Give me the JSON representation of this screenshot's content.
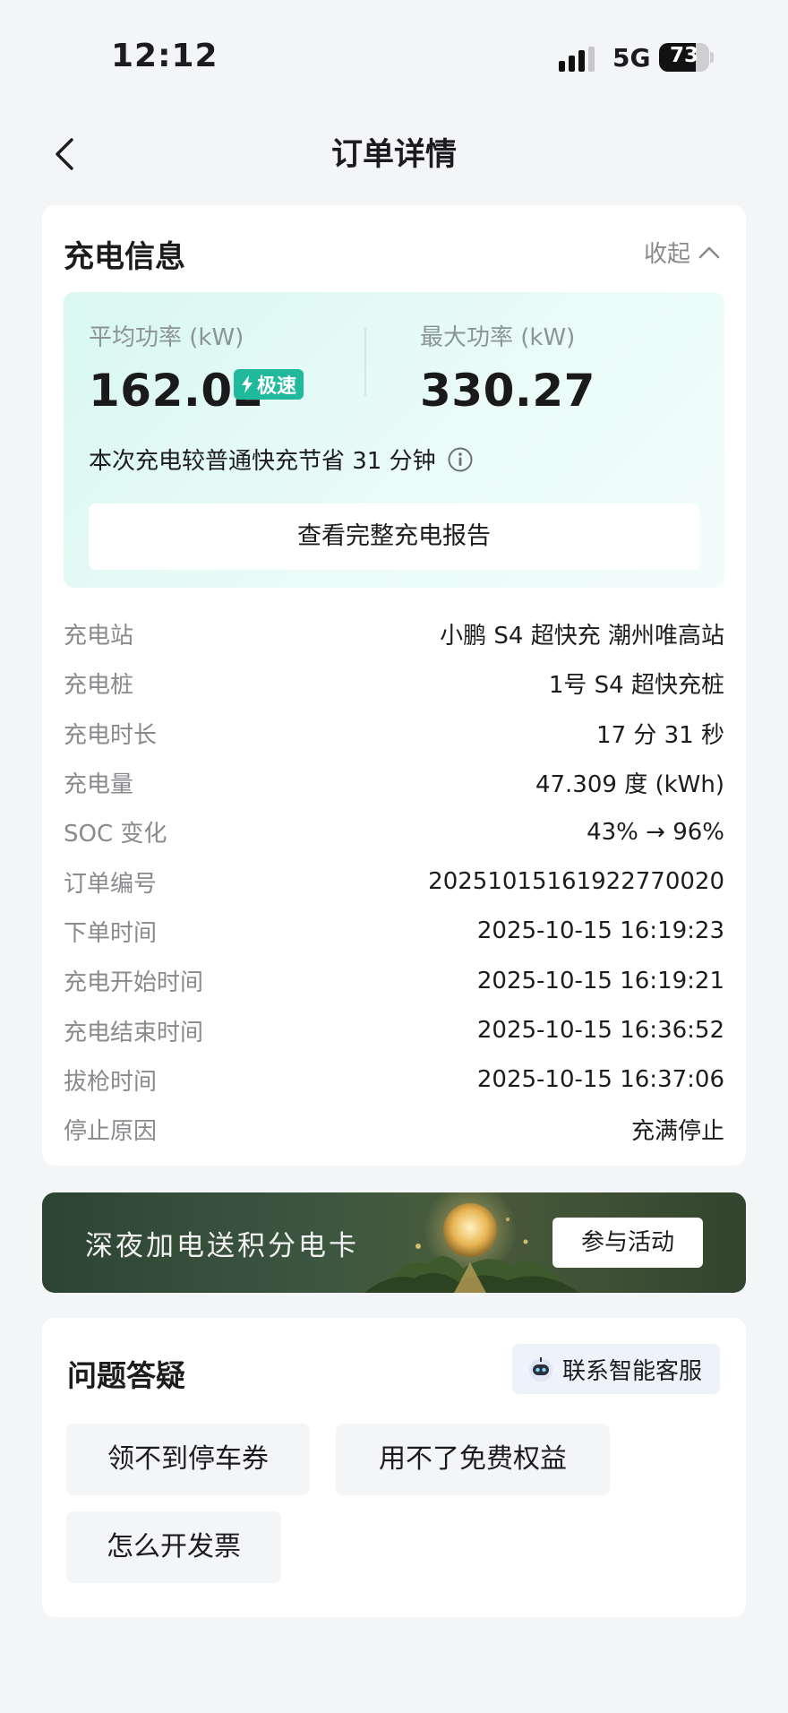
{
  "status_bar": {
    "time": "12:12",
    "network": "5G",
    "battery": "73",
    "battery_level": 0.73
  },
  "nav": {
    "title": "订单详情"
  },
  "charge_info": {
    "title": "充电信息",
    "collapse_label": "收起",
    "avg_power_label": "平均功率 (kW)",
    "avg_power_value": "162.02",
    "speed_badge": "极速",
    "max_power_label": "最大功率 (kW)",
    "max_power_value": "330.27",
    "saving_text": "本次充电较普通快充节省 31 分钟",
    "report_button": "查看完整充电报告",
    "details": [
      {
        "label": "充电站",
        "value": "小鹏 S4 超快充 潮州唯高站"
      },
      {
        "label": "充电桩",
        "value": "1号 S4 超快充桩"
      },
      {
        "label": "充电时长",
        "value": "17 分 31 秒"
      },
      {
        "label": "充电量",
        "value": "47.309 度 (kWh)"
      },
      {
        "label": "SOC 变化",
        "value": "43% → 96%"
      },
      {
        "label": "订单编号",
        "value": "20251015161922770020"
      },
      {
        "label": "下单时间",
        "value": "2025-10-15 16:19:23"
      },
      {
        "label": "充电开始时间",
        "value": "2025-10-15 16:19:21"
      },
      {
        "label": "充电结束时间",
        "value": "2025-10-15 16:36:52"
      },
      {
        "label": "拔枪时间",
        "value": "2025-10-15 16:37:06"
      },
      {
        "label": "停止原因",
        "value": "充满停止"
      }
    ]
  },
  "banner": {
    "text": "深夜加电送积分电卡",
    "button": "参与活动"
  },
  "faq": {
    "title": "问题答疑",
    "customer_service": "联系智能客服",
    "chips": [
      "领不到停车券",
      "用不了免费权益",
      "怎么开发票"
    ]
  },
  "colors": {
    "accent": "#21b99b",
    "banner_bg": "#3d5640",
    "page_bg": "#f4f5f7"
  }
}
